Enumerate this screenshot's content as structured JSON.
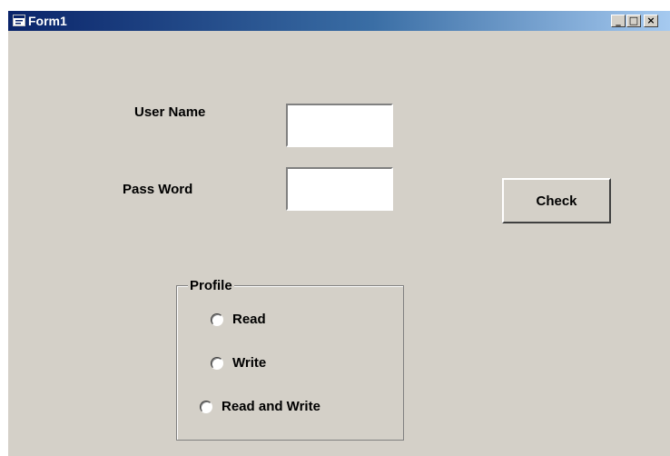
{
  "window": {
    "title": "Form1",
    "title_icon": "form-window-icon",
    "controls": {
      "minimize": "_",
      "maximize": "□",
      "close": "×"
    },
    "colors": {
      "title_start": "#0a246a",
      "title_end": "#a6caf0",
      "face": "#d4d0c8"
    }
  },
  "form": {
    "username_label": "User Name",
    "username_value": "",
    "password_label": "Pass Word",
    "password_value": "",
    "check_button": "Check"
  },
  "profile": {
    "legend": "Profile",
    "options": [
      {
        "label": "Read"
      },
      {
        "label": "Write"
      },
      {
        "label": "Read and Write"
      }
    ]
  }
}
